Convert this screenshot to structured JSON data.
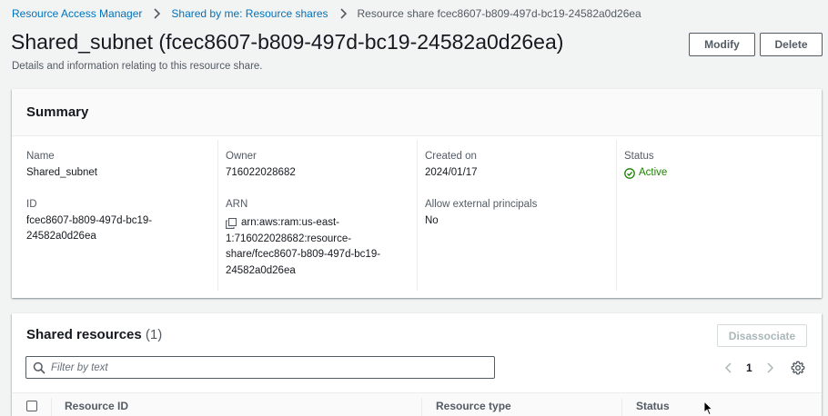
{
  "breadcrumb": {
    "items": [
      "Resource Access Manager",
      "Shared by me: Resource shares"
    ],
    "current": "Resource share fcec8607-b809-497d-bc19-24582a0d26ea"
  },
  "header": {
    "title": "Shared_subnet (fcec8607-b809-497d-bc19-24582a0d26ea)",
    "description": "Details and information relating to this resource share.",
    "modify_label": "Modify",
    "delete_label": "Delete"
  },
  "summary": {
    "title": "Summary",
    "name_label": "Name",
    "name_value": "Shared_subnet",
    "id_label": "ID",
    "id_value_line1": "fcec8607-b809-497d-bc19-",
    "id_value_line2": "24582a0d26ea",
    "owner_label": "Owner",
    "owner_value": "716022028682",
    "arn_label": "ARN",
    "arn_lines": [
      "arn:aws:ram:us-east-",
      "1:716022028682:resource-",
      "share/fcec8607-b809-497d-bc19-",
      "24582a0d26ea"
    ],
    "created_label": "Created on",
    "created_value": "2024/01/17",
    "external_label": "Allow external principals",
    "external_value": "No",
    "status_label": "Status",
    "status_value": "Active"
  },
  "shared_resources": {
    "title": "Shared resources",
    "count": "(1)",
    "disassociate_label": "Disassociate",
    "filter_placeholder": "Filter by text",
    "page": "1",
    "columns": [
      "Resource ID",
      "Resource type",
      "Status"
    ]
  },
  "colors": {
    "link": "#0073bb",
    "status_active": "#1d8102",
    "disabled": "#aab7b8"
  },
  "icons": [
    "chevron-right-icon",
    "copy-icon",
    "check-circle-icon",
    "search-icon",
    "chevron-left-icon",
    "gear-icon",
    "mouse-cursor-icon"
  ]
}
